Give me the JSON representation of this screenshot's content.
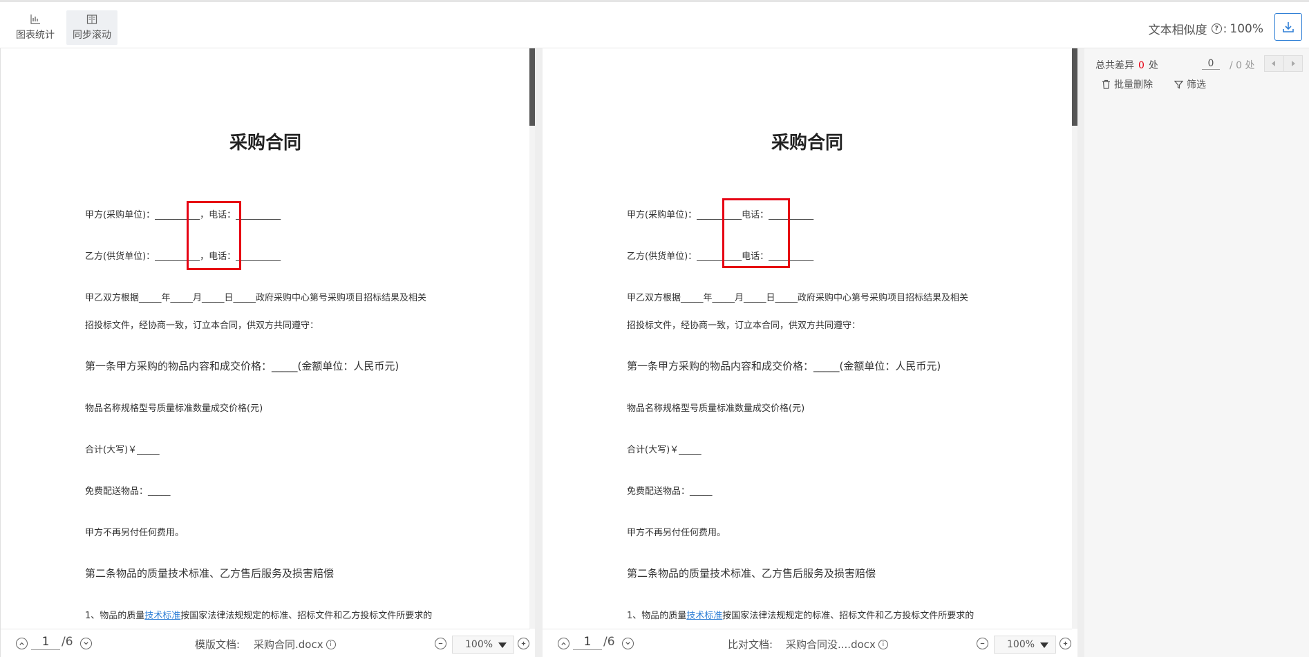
{
  "toolbar": {
    "chart_label": "图表统计",
    "sync_label": "同步滚动"
  },
  "header": {
    "similarity_label": "文本相似度",
    "similarity_colon": ":",
    "similarity_value": "100%"
  },
  "left_doc": {
    "title": "采购合同",
    "lines": [
      "甲方(采购单位)：__________，电话：__________",
      "乙方(供货单位)：__________，电话：__________",
      "甲乙双方根据_____年_____月_____日_____政府采购中心第号采购项目招标结果及相关",
      "招投标文件，经协商一致，订立本合同，供双方共同遵守：",
      "第一条甲方采购的物品内容和成交价格：_____(金额单位：人民币元)",
      "物品名称规格型号质量标准数量成交价格(元)",
      "合计(大写)￥_____",
      "免费配送物品：_____",
      "甲方不再另付任何费用。",
      "第二条物品的质量技术标准、乙方售后服务及损害赔偿"
    ],
    "last_line_prefix": "1、物品的质量",
    "last_line_link": "技术标准",
    "last_line_suffix": "按国家法律法规规定的标准、招标文件和乙方投标文件所要求的",
    "page_current": "1",
    "page_total": "/6",
    "doc_label": "模版文档:",
    "doc_file": "采购合同.docx",
    "zoom": "100%"
  },
  "right_doc": {
    "title": "采购合同",
    "lines": [
      "甲方(采购单位)：__________电话：__________",
      "乙方(供货单位)：__________电话：__________",
      "甲乙双方根据_____年_____月_____日_____政府采购中心第号采购项目招标结果及相关",
      "招投标文件，经协商一致，订立本合同，供双方共同遵守：",
      "第一条甲方采购的物品内容和成交价格：_____(金额单位：人民币元)",
      "物品名称规格型号质量标准数量成交价格(元)",
      "合计(大写)￥_____",
      "免费配送物品：_____",
      "甲方不再另付任何费用。",
      "第二条物品的质量技术标准、乙方售后服务及损害赔偿"
    ],
    "last_line_prefix": "1、物品的质量",
    "last_line_link": "技术标准",
    "last_line_suffix": "按国家法律法规规定的标准、招标文件和乙方投标文件所要求的",
    "page_current": "1",
    "page_total": "/6",
    "doc_label": "比对文档:",
    "doc_file": "采购合同没....docx",
    "zoom": "100%"
  },
  "side": {
    "total_label": "总共差异",
    "total_count": "0",
    "total_unit": "处",
    "nav_current": "0",
    "nav_total": "/ 0 处",
    "batch_delete": "批量删除",
    "filter": "筛选"
  },
  "colors": {
    "accent": "#2f7fd6",
    "diff_red": "#e60012"
  }
}
